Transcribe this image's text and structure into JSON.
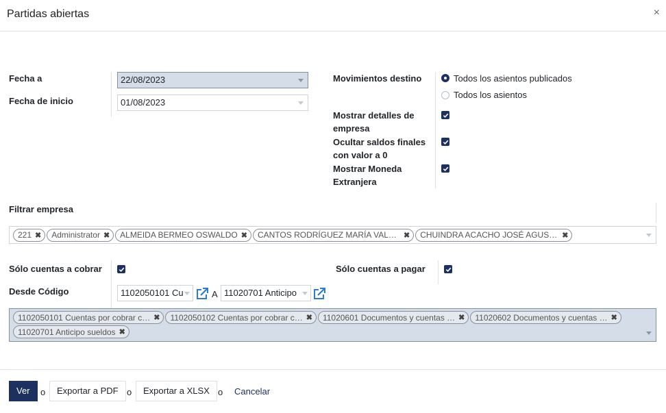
{
  "dialog": {
    "title": "Partidas abiertas",
    "close_glyph": "×"
  },
  "dates": {
    "date_to_label": "Fecha a",
    "date_to_value": "22/08/2023",
    "date_from_label": "Fecha de inicio",
    "date_from_value": "01/08/2023"
  },
  "target_moves": {
    "label": "Movimientos destino",
    "options": [
      {
        "label": "Todos los asientos publicados",
        "selected": true
      },
      {
        "label": "Todos los asientos",
        "selected": false
      }
    ]
  },
  "options": {
    "show_partner_details": {
      "label_line1": "Mostrar detalles de",
      "label_line2": "empresa",
      "checked": true
    },
    "hide_zero_balance": {
      "label_line1": "Ocultar saldos finales",
      "label_line2": "con valor a 0",
      "checked": true
    },
    "foreign_currency": {
      "label_line1": "Mostrar Moneda",
      "label_line2": "Extranjera",
      "checked": true
    }
  },
  "partner_filter": {
    "label": "Filtrar empresa",
    "tags": [
      "221",
      "Administrator",
      "ALMEIDA BERMEO OSWALDO",
      "CANTOS RODRÍGUEZ MARÍA VALE…",
      "CHUINDRA ACACHO JOSÉ AGUST…"
    ]
  },
  "receivable": {
    "label": "Sólo cuentas a cobrar",
    "checked": true
  },
  "payable": {
    "label": "Sólo cuentas a pagar",
    "checked": true
  },
  "account_range": {
    "label": "Desde Código",
    "from_value": "1102050101 Cu",
    "to_label": "A",
    "to_value": "11020701 Anticipo",
    "tags": [
      "1102050101 Cuentas por cobrar c…",
      "1102050102 Cuentas por cobrar c…",
      "11020601 Documentos y cuentas …",
      "11020602 Documentos y cuentas …",
      "11020701 Anticipo sueldos"
    ]
  },
  "footer": {
    "view_label": "Ver",
    "export_pdf_label": "Exportar a PDF",
    "export_xlsx_label": "Exportar a XLSX",
    "cancel_label": "Cancelar",
    "or_label": "o"
  },
  "colors": {
    "primary": "#1c3160",
    "highlight_field": "#d5dee8",
    "link_icon": "#2b7bd3"
  },
  "icons": {
    "remove": "remove-x-icon",
    "external": "external-link-icon",
    "check": "checkmark-icon"
  }
}
